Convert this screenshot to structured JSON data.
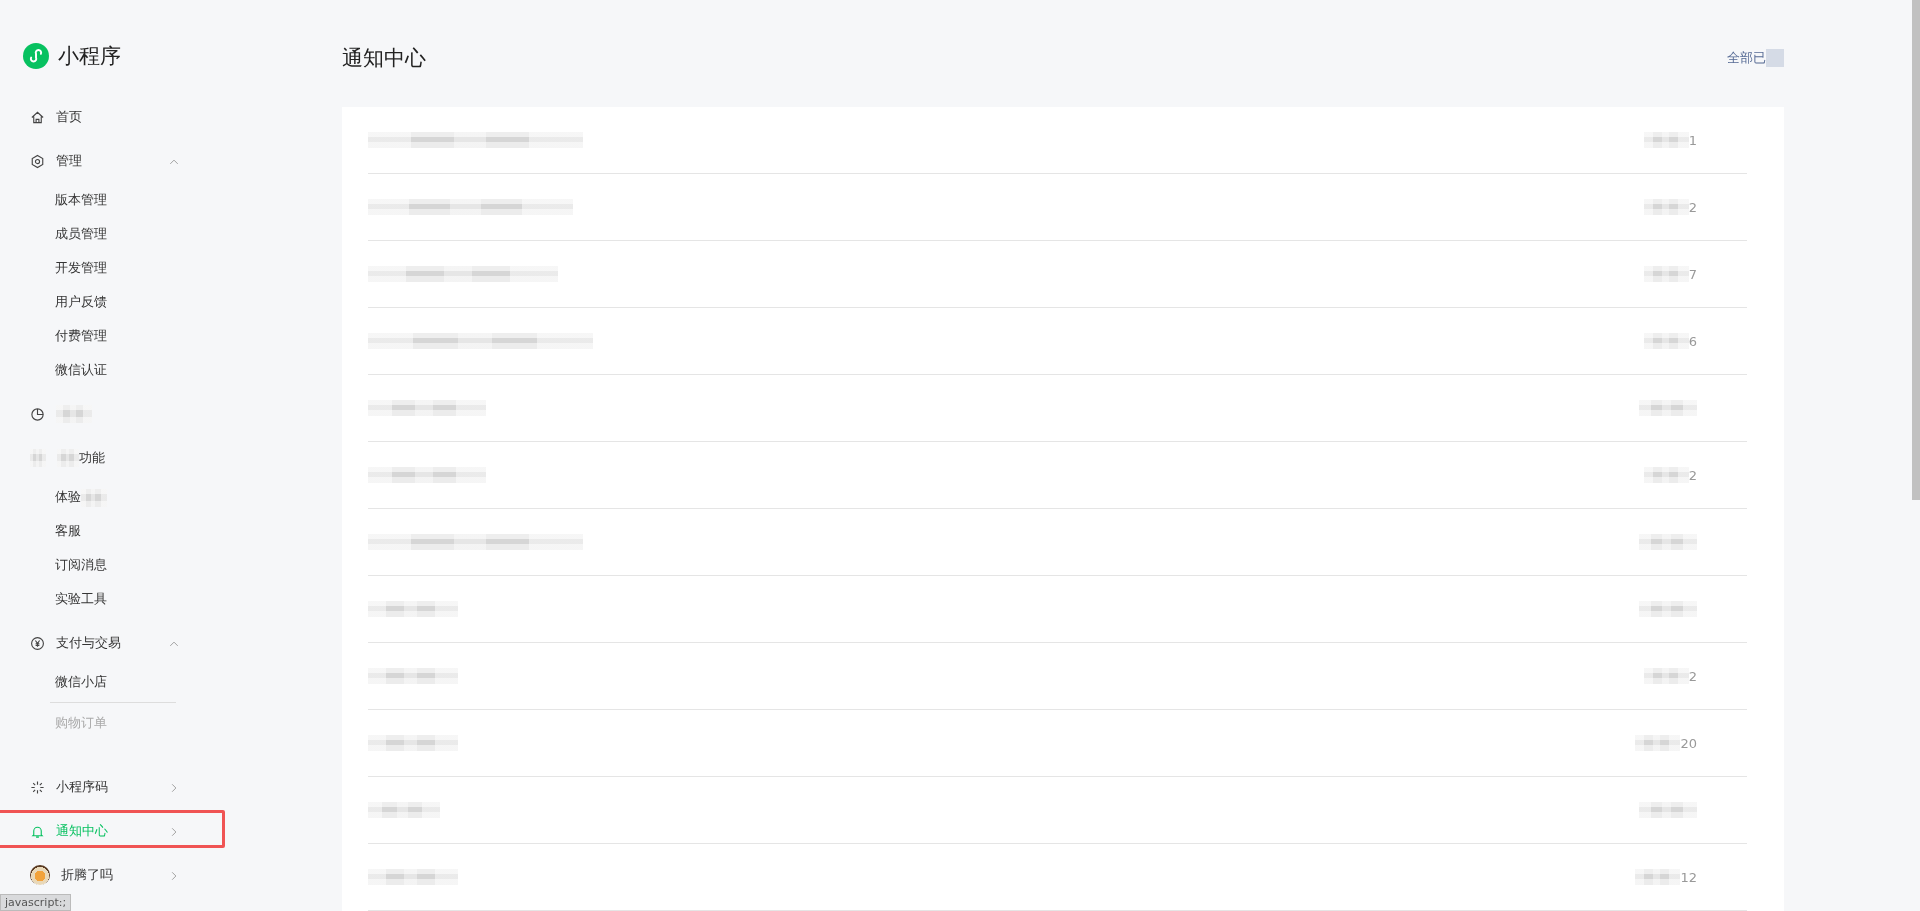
{
  "app": {
    "name": "小程序"
  },
  "sidebar": {
    "sections": [
      {
        "label": "首页",
        "selected": false
      },
      {
        "label": "管理",
        "selected": false,
        "expanded": true,
        "children": [
          {
            "label": "版本管理",
            "disabled": false
          },
          {
            "label": "成员管理",
            "disabled": false
          },
          {
            "label": "开发管理",
            "disabled": false
          },
          {
            "label": "用户反馈",
            "disabled": false
          },
          {
            "label": "付费管理",
            "disabled": false
          },
          {
            "label": "微信认证",
            "disabled": false
          }
        ]
      },
      {
        "masked": true,
        "selected": false
      },
      {
        "label": "功能",
        "masked_before": true,
        "selected": false,
        "children": [
          {
            "label": "体验",
            "masked_after": true,
            "disabled": false
          },
          {
            "label": "客服",
            "disabled": false
          },
          {
            "label": "订阅消息",
            "disabled": false
          },
          {
            "label": "实验工具",
            "disabled": false
          }
        ]
      },
      {
        "label": "支付与交易",
        "selected": false,
        "expanded": true,
        "children": [
          {
            "label": "微信小店",
            "disabled": false
          },
          {
            "label": "购物订单",
            "disabled": true
          }
        ]
      },
      {
        "label": "小程序码",
        "selected": false,
        "expanded": false
      },
      {
        "label": "通知中心",
        "selected": true,
        "expanded": false
      },
      {
        "label": "折腾了吗",
        "selected": false,
        "expanded": false
      }
    ]
  },
  "page": {
    "title": "通知中心",
    "action": {
      "label": "全部已",
      "masked_after": true
    }
  },
  "notices": [
    {
      "kind": "masked",
      "date": "1"
    },
    {
      "kind": "masked",
      "date": "2"
    },
    {
      "kind": "masked",
      "date": "7"
    },
    {
      "kind": "masked",
      "date": "6"
    },
    {
      "kind": "masked"
    },
    {
      "kind": "masked",
      "date": "2"
    },
    {
      "kind": "masked"
    },
    {
      "kind": "masked"
    },
    {
      "kind": "masked",
      "date": "2"
    },
    {
      "kind": "masked",
      "date": "20"
    },
    {
      "kind": "masked"
    },
    {
      "kind": "masked",
      "date": "12"
    }
  ],
  "status_bar": {
    "text": "javascript:;"
  }
}
